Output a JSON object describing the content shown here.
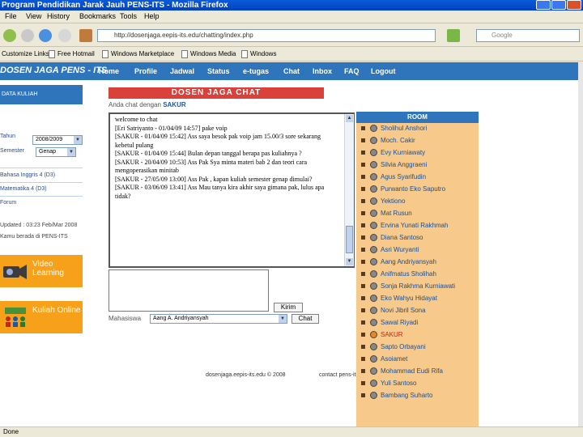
{
  "window": {
    "title": "Program Pendidikan Jarak Jauh PENS-ITS - Mozilla Firefox"
  },
  "menu": [
    "File",
    "View",
    "History",
    "Bookmarks",
    "Tools",
    "Help"
  ],
  "browser": {
    "url": "http://dosenjaga.eepis-its.edu/chatting/index.php",
    "search_placeholder": "Google"
  },
  "bookmarks": [
    "Customize Links",
    "Free Hotmail",
    "Windows Marketplace",
    "Windows Media",
    "Windows"
  ],
  "site": {
    "logo": "DOSEN JAGA PENS - ITS",
    "nav": [
      "Home",
      "Profile",
      "Jadwal",
      "Status",
      "e-tugas",
      "Chat",
      "Inbox",
      "FAQ",
      "Logout"
    ]
  },
  "sidebar": {
    "header": "DATA KULIAH",
    "tahun_label": "Tahun",
    "tahun_value": "2008/2009",
    "semester_label": "Semester",
    "semester_value": "Genap",
    "courses": [
      "Bahasa Inggris 4 (D3)",
      "Matematika 4 (D3)",
      "Forum"
    ],
    "update_line1": "Updated : 03:23 Feb/Mar 2008",
    "update_line2": "Kamu berada di PENS-ITS",
    "promo1": "Video Learning",
    "promo2": "Kuliah Online"
  },
  "chat": {
    "title": "DOSEN JAGA CHAT",
    "with_prefix": "Anda chat dengan",
    "with_user": "SAKUR",
    "lines": [
      "welcome to chat",
      "[Eri Satriyanto - 01/04/09 14:57] pake voip",
      "[SAKUR - 01/04/09 15:42] Ass saya besok pak voip jam 15.00/3 sore sekarang kebetul pulang",
      "[SAKUR - 01/04/09 15:44] Bulan depan tanggal berapa pas kuliahnya ?",
      "[SAKUR - 20/04/09 10:53] Ass Pak Sya minta materi bab 2 dan teori cara mengoperasikan minitab",
      "[SAKUR - 27/05/09 13:00] Ass Pak , kapan kuliah semester genap dimulai?",
      "[SAKUR - 03/06/09 13:41] Ass Mau tanya kira akhir saya gimana pak, lulus apa tidak?"
    ],
    "send_label": "Kirim",
    "mhs_label": "Mahasiswa",
    "mhs_value": "Aang A. Andriyansyah",
    "chat_button": "Chat",
    "footer_left": "dosenjaga.eepis-its.edu © 2008",
    "footer_right": "contact pens-its"
  },
  "room": {
    "header": "ROOM",
    "users": [
      "Sholihul Anshori",
      "Moch. Cakir",
      "Evy Kurniawaty",
      "Silvia Anggraeni",
      "Agus Syarifudin",
      "Purwanto Eko Saputro",
      "Yektiono",
      "Mat Rusun",
      "Ervina Yunati Rakhmah",
      "Diana Santoso",
      "Asri Wuryanti",
      "Aang Andriyansyah",
      "Anifmatus Sholihah",
      "Sonja Rakhma Kurniawati",
      "Eko Wahyu Hidayat",
      "Novi Jibril Sona",
      "Sawal Riyadi",
      "SAKUR",
      "Sapto Orbayani",
      "Asoiamet",
      "Mohammad Eudi Rifa",
      "Yuli Santoso",
      "Bambang Suharto"
    ],
    "selected": "SAKUR"
  },
  "status": {
    "text": "Done"
  }
}
